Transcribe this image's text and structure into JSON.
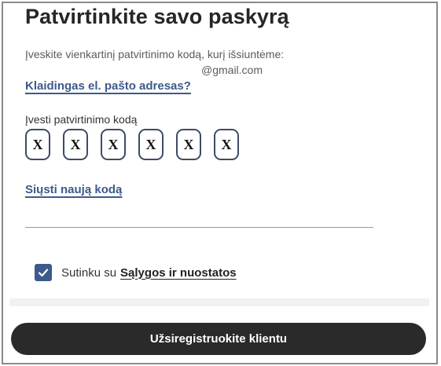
{
  "title": "Patvirtinkite savo paskyrą",
  "intro_text": "Įveskite vienkartinį patvirtinimo kodą, kurį išsiuntėme:",
  "email": "@gmail.com",
  "wrong_email_link": "Klaidingas el. pašto adresas?",
  "code_label": "Įvesti patvirtinimo kodą",
  "code_digits": [
    "X",
    "X",
    "X",
    "X",
    "X",
    "X"
  ],
  "resend_link": "Siųsti naują kodą",
  "terms": {
    "checked": true,
    "prefix": "Sutinku su",
    "link": "Sąlygos ir nuostatos"
  },
  "register_button": "Užsiregistruokite klientu",
  "colors": {
    "accent": "#3d5a8a",
    "button_bg": "#2a2a2a"
  }
}
